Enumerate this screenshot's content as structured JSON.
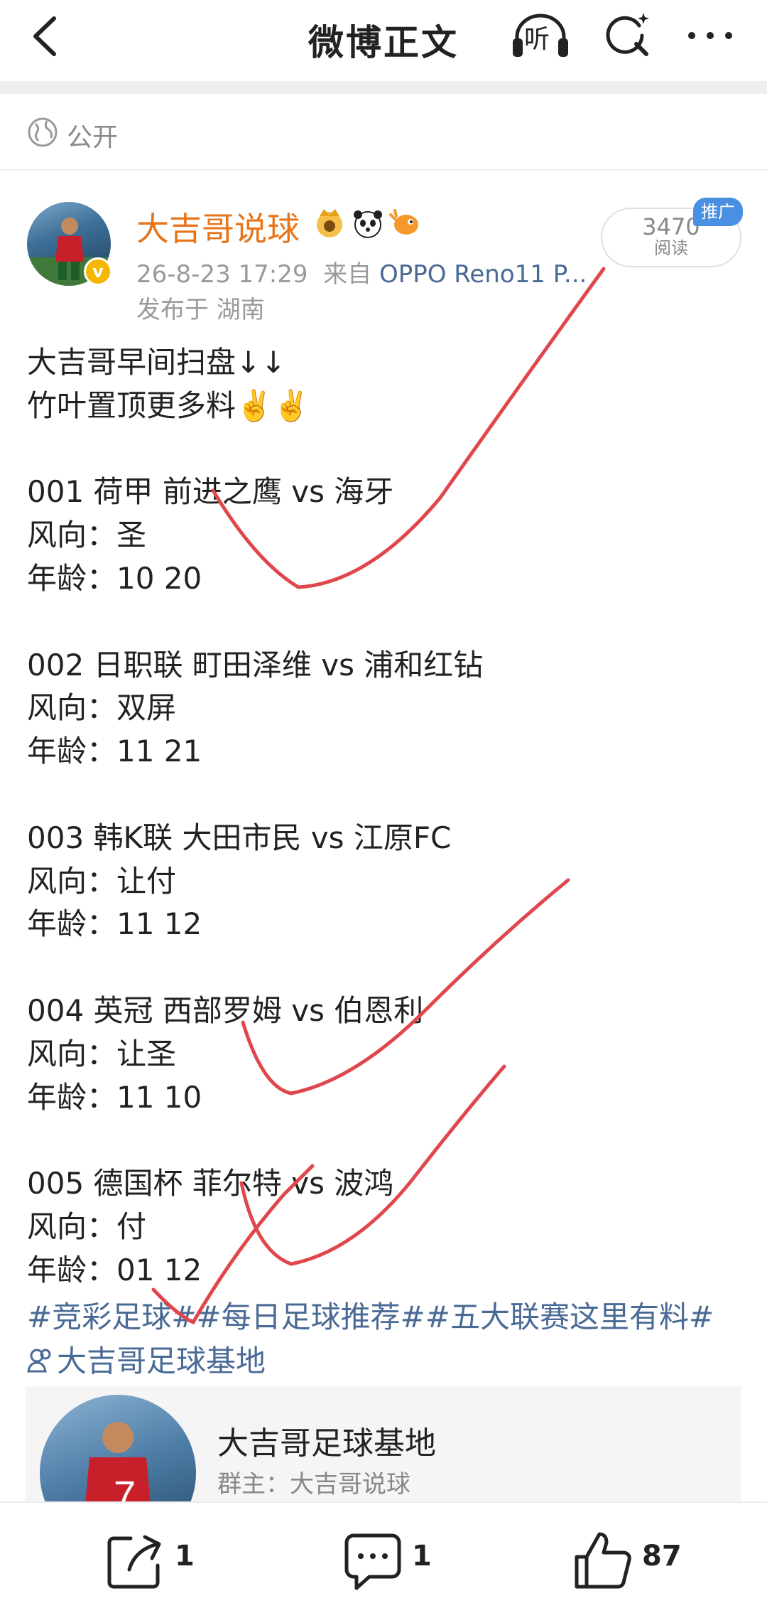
{
  "nav": {
    "title": "微博正文",
    "listen_label": "听"
  },
  "visibility": {
    "label": "公开"
  },
  "author": {
    "name": "大吉哥说球",
    "timestamp": "26-8-23 17:29",
    "source_prefix": "来自",
    "source_device": "OPPO Reno11 P...",
    "location": "发布于 湖南",
    "reads_count": "3470",
    "reads_label": "阅读",
    "promo_badge": "推广"
  },
  "post": {
    "lines": [
      "大吉哥早间扫盘↓↓",
      "竹叶置顶更多料✌️✌️",
      "",
      "001 荷甲 前进之鹰 vs 海牙",
      "风向：圣",
      "年龄：10  20",
      "",
      "002 日职联 町田泽维 vs 浦和红钻",
      "风向：双屏",
      "年龄：11  21",
      "",
      "003 韩K联 大田市民 vs 江原FC",
      "风向：让付",
      "年龄：11  12",
      "",
      "004 英冠 西部罗姆 vs 伯恩利",
      "风向：让圣",
      "年龄：11  10",
      "",
      "005 德国杯 菲尔特 vs 波鸿",
      "风向：付",
      "年龄：01  12"
    ],
    "tags_line1": "#竞彩足球##每日足球推荐##五大联赛这里有料#",
    "tags_line2": "大吉哥足球基地"
  },
  "group_card": {
    "name": "大吉哥足球基地",
    "owner": "群主：大吉哥说球"
  },
  "actions": {
    "repost_count": "1",
    "comment_count": "1",
    "like_count": "87"
  },
  "colors": {
    "author_name": "#e8751a",
    "link": "#4a6a96",
    "annotation": "#e0474c",
    "promo": "#4a90e2"
  },
  "icons": [
    "back-arrow-icon",
    "headphones-icon",
    "search-sparkle-icon",
    "more-dots-icon",
    "globe-icon",
    "verified-icon",
    "crown-badge-icon",
    "panda-badge-icon",
    "fish-badge-icon",
    "group-icon",
    "repost-icon",
    "comment-icon",
    "like-icon"
  ]
}
